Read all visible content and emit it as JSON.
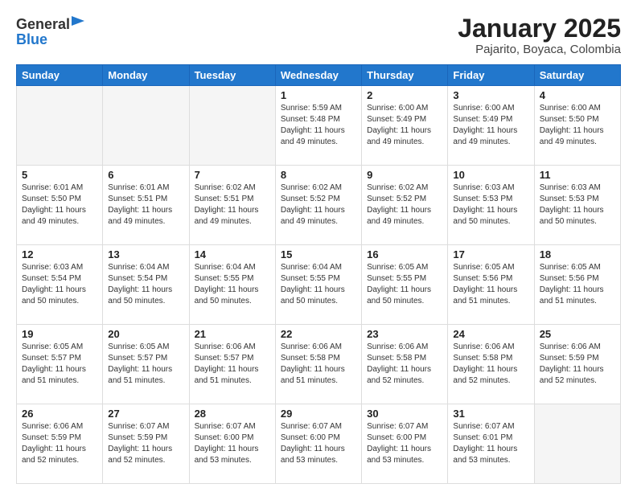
{
  "header": {
    "logo_general": "General",
    "logo_blue": "Blue",
    "title": "January 2025",
    "subtitle": "Pajarito, Boyaca, Colombia"
  },
  "weekdays": [
    "Sunday",
    "Monday",
    "Tuesday",
    "Wednesday",
    "Thursday",
    "Friday",
    "Saturday"
  ],
  "weeks": [
    [
      {
        "day": "",
        "info": ""
      },
      {
        "day": "",
        "info": ""
      },
      {
        "day": "",
        "info": ""
      },
      {
        "day": "1",
        "info": "Sunrise: 5:59 AM\nSunset: 5:48 PM\nDaylight: 11 hours\nand 49 minutes."
      },
      {
        "day": "2",
        "info": "Sunrise: 6:00 AM\nSunset: 5:49 PM\nDaylight: 11 hours\nand 49 minutes."
      },
      {
        "day": "3",
        "info": "Sunrise: 6:00 AM\nSunset: 5:49 PM\nDaylight: 11 hours\nand 49 minutes."
      },
      {
        "day": "4",
        "info": "Sunrise: 6:00 AM\nSunset: 5:50 PM\nDaylight: 11 hours\nand 49 minutes."
      }
    ],
    [
      {
        "day": "5",
        "info": "Sunrise: 6:01 AM\nSunset: 5:50 PM\nDaylight: 11 hours\nand 49 minutes."
      },
      {
        "day": "6",
        "info": "Sunrise: 6:01 AM\nSunset: 5:51 PM\nDaylight: 11 hours\nand 49 minutes."
      },
      {
        "day": "7",
        "info": "Sunrise: 6:02 AM\nSunset: 5:51 PM\nDaylight: 11 hours\nand 49 minutes."
      },
      {
        "day": "8",
        "info": "Sunrise: 6:02 AM\nSunset: 5:52 PM\nDaylight: 11 hours\nand 49 minutes."
      },
      {
        "day": "9",
        "info": "Sunrise: 6:02 AM\nSunset: 5:52 PM\nDaylight: 11 hours\nand 49 minutes."
      },
      {
        "day": "10",
        "info": "Sunrise: 6:03 AM\nSunset: 5:53 PM\nDaylight: 11 hours\nand 50 minutes."
      },
      {
        "day": "11",
        "info": "Sunrise: 6:03 AM\nSunset: 5:53 PM\nDaylight: 11 hours\nand 50 minutes."
      }
    ],
    [
      {
        "day": "12",
        "info": "Sunrise: 6:03 AM\nSunset: 5:54 PM\nDaylight: 11 hours\nand 50 minutes."
      },
      {
        "day": "13",
        "info": "Sunrise: 6:04 AM\nSunset: 5:54 PM\nDaylight: 11 hours\nand 50 minutes."
      },
      {
        "day": "14",
        "info": "Sunrise: 6:04 AM\nSunset: 5:55 PM\nDaylight: 11 hours\nand 50 minutes."
      },
      {
        "day": "15",
        "info": "Sunrise: 6:04 AM\nSunset: 5:55 PM\nDaylight: 11 hours\nand 50 minutes."
      },
      {
        "day": "16",
        "info": "Sunrise: 6:05 AM\nSunset: 5:55 PM\nDaylight: 11 hours\nand 50 minutes."
      },
      {
        "day": "17",
        "info": "Sunrise: 6:05 AM\nSunset: 5:56 PM\nDaylight: 11 hours\nand 51 minutes."
      },
      {
        "day": "18",
        "info": "Sunrise: 6:05 AM\nSunset: 5:56 PM\nDaylight: 11 hours\nand 51 minutes."
      }
    ],
    [
      {
        "day": "19",
        "info": "Sunrise: 6:05 AM\nSunset: 5:57 PM\nDaylight: 11 hours\nand 51 minutes."
      },
      {
        "day": "20",
        "info": "Sunrise: 6:05 AM\nSunset: 5:57 PM\nDaylight: 11 hours\nand 51 minutes."
      },
      {
        "day": "21",
        "info": "Sunrise: 6:06 AM\nSunset: 5:57 PM\nDaylight: 11 hours\nand 51 minutes."
      },
      {
        "day": "22",
        "info": "Sunrise: 6:06 AM\nSunset: 5:58 PM\nDaylight: 11 hours\nand 51 minutes."
      },
      {
        "day": "23",
        "info": "Sunrise: 6:06 AM\nSunset: 5:58 PM\nDaylight: 11 hours\nand 52 minutes."
      },
      {
        "day": "24",
        "info": "Sunrise: 6:06 AM\nSunset: 5:58 PM\nDaylight: 11 hours\nand 52 minutes."
      },
      {
        "day": "25",
        "info": "Sunrise: 6:06 AM\nSunset: 5:59 PM\nDaylight: 11 hours\nand 52 minutes."
      }
    ],
    [
      {
        "day": "26",
        "info": "Sunrise: 6:06 AM\nSunset: 5:59 PM\nDaylight: 11 hours\nand 52 minutes."
      },
      {
        "day": "27",
        "info": "Sunrise: 6:07 AM\nSunset: 5:59 PM\nDaylight: 11 hours\nand 52 minutes."
      },
      {
        "day": "28",
        "info": "Sunrise: 6:07 AM\nSunset: 6:00 PM\nDaylight: 11 hours\nand 53 minutes."
      },
      {
        "day": "29",
        "info": "Sunrise: 6:07 AM\nSunset: 6:00 PM\nDaylight: 11 hours\nand 53 minutes."
      },
      {
        "day": "30",
        "info": "Sunrise: 6:07 AM\nSunset: 6:00 PM\nDaylight: 11 hours\nand 53 minutes."
      },
      {
        "day": "31",
        "info": "Sunrise: 6:07 AM\nSunset: 6:01 PM\nDaylight: 11 hours\nand 53 minutes."
      },
      {
        "day": "",
        "info": ""
      }
    ]
  ]
}
